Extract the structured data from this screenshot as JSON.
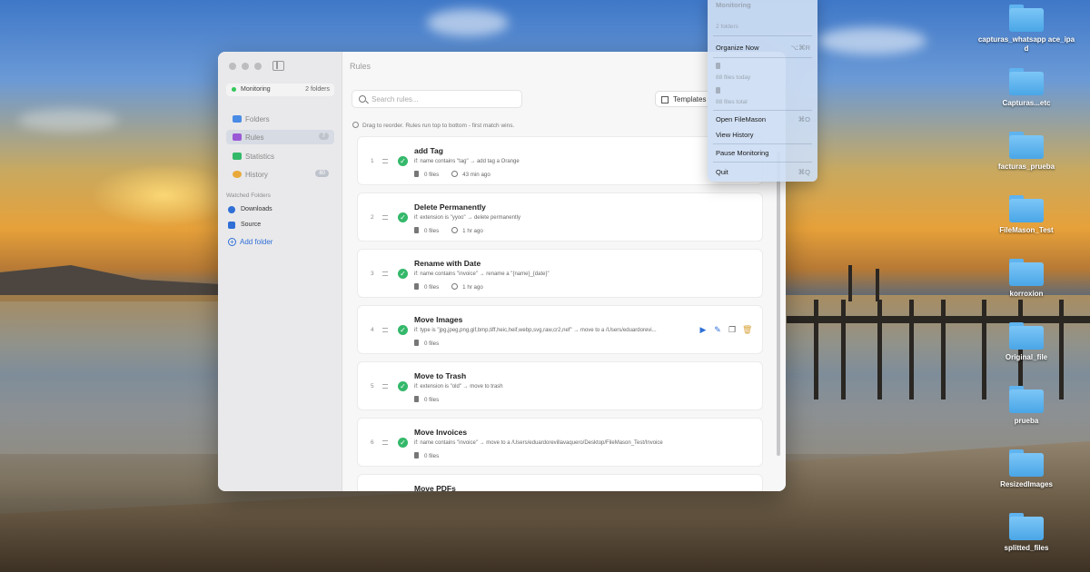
{
  "window": {
    "title": "Rules"
  },
  "sidebar": {
    "monitoring_label": "Monitoring",
    "monitoring_count": "2 folders",
    "nav": [
      {
        "label": "Folders",
        "badge": ""
      },
      {
        "label": "Rules",
        "badge": "7"
      },
      {
        "label": "Statistics",
        "badge": ""
      },
      {
        "label": "History",
        "badge": "80"
      }
    ],
    "watched_title": "Watched Folders",
    "watched": [
      "Downloads",
      "Source"
    ],
    "add_folder": "Add folder"
  },
  "toolbar": {
    "search_placeholder": "Search rules...",
    "templates_label": "Templates"
  },
  "hint": "Drag to reorder. Rules run top to bottom - first match wins.",
  "rules": [
    {
      "num": "1",
      "name": "add Tag",
      "cond": "if: name contains \"tag\" → add tag a Orange",
      "files": "0 files",
      "time": "43 min ago"
    },
    {
      "num": "2",
      "name": "Delete Permanently",
      "cond": "if: extension is \"yyoo\" → delete permanently",
      "files": "0 files",
      "time": "1 hr ago"
    },
    {
      "num": "3",
      "name": "Rename with Date",
      "cond": "if: name contains \"invoice\" → rename a \"{name}_{date}\"",
      "files": "0 files",
      "time": "1 hr ago"
    },
    {
      "num": "4",
      "name": "Move Images",
      "cond": "if: type is \"jpg,jpeg,png,gif,bmp,tiff,heic,heif,webp,svg,raw,cr2,nef\" → move to a /Users/eduardorevi...",
      "files": "0 files",
      "time": ""
    },
    {
      "num": "5",
      "name": "Move to Trash",
      "cond": "if: extension is \"old\" → move to trash",
      "files": "0 files",
      "time": ""
    },
    {
      "num": "6",
      "name": "Move Invoices",
      "cond": "if: name contains \"invoice\" → move to a /Users/eduardorevillavaquero/Desktop/FileMason_Test/Invoice",
      "files": "0 files",
      "time": ""
    },
    {
      "num": "",
      "name": "Move PDFs",
      "cond": "",
      "files": "",
      "time": ""
    }
  ],
  "menu": {
    "header": "Monitoring",
    "folders": "2 folders",
    "organize": "Organize Now",
    "organize_sc": "⌥⌘R",
    "files_today": "88 files today",
    "files_total": "88 files total",
    "open": "Open FileMason",
    "open_sc": "⌘O",
    "history": "View History",
    "pause": "Pause Monitoring",
    "quit": "Quit",
    "quit_sc": "⌘Q"
  },
  "desktop": [
    "capturas_whatsapp ace_ipad",
    "Capturas...etc",
    "facturas_prueba",
    "FileMason_Test",
    "korroxion",
    "Original_file",
    "prueba",
    "ResizedImages",
    "splitted_files"
  ],
  "colors": {
    "accent": "#2f6fd6",
    "success": "#34b86a",
    "monitoring": "#34c759"
  }
}
